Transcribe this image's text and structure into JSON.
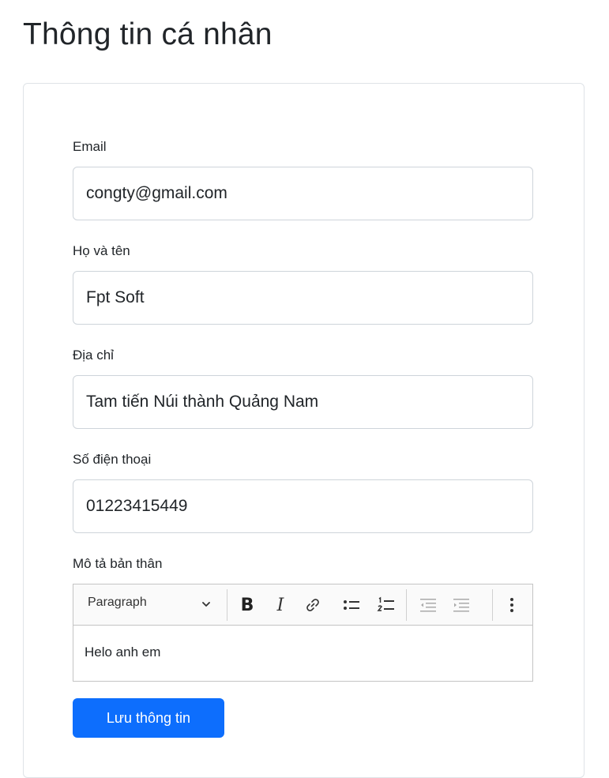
{
  "page": {
    "title": "Thông tin cá nhân"
  },
  "form": {
    "email": {
      "label": "Email",
      "value": "congty@gmail.com"
    },
    "fullname": {
      "label": "Họ và tên",
      "value": "Fpt Soft"
    },
    "address": {
      "label": "Địa chỉ",
      "value": "Tam tiến Núi thành Quảng Nam"
    },
    "phone": {
      "label": "Số điện thoại",
      "value": "01223415449"
    },
    "bio": {
      "label": "Mô tả bản thân",
      "content": "Helo anh em",
      "toolbar": {
        "paragraph_select": "Paragraph",
        "bold_glyph": "B",
        "italic_glyph": "I"
      }
    },
    "save_label": "Lưu thông tin"
  },
  "colors": {
    "primary": "#0d6efd",
    "border": "#ced4da",
    "text": "#212529"
  },
  "icons": [
    "chevron-down-icon",
    "bold-icon",
    "italic-icon",
    "link-icon",
    "bulleted-list-icon",
    "numbered-list-icon",
    "outdent-icon",
    "indent-icon",
    "more-vertical-icon"
  ]
}
